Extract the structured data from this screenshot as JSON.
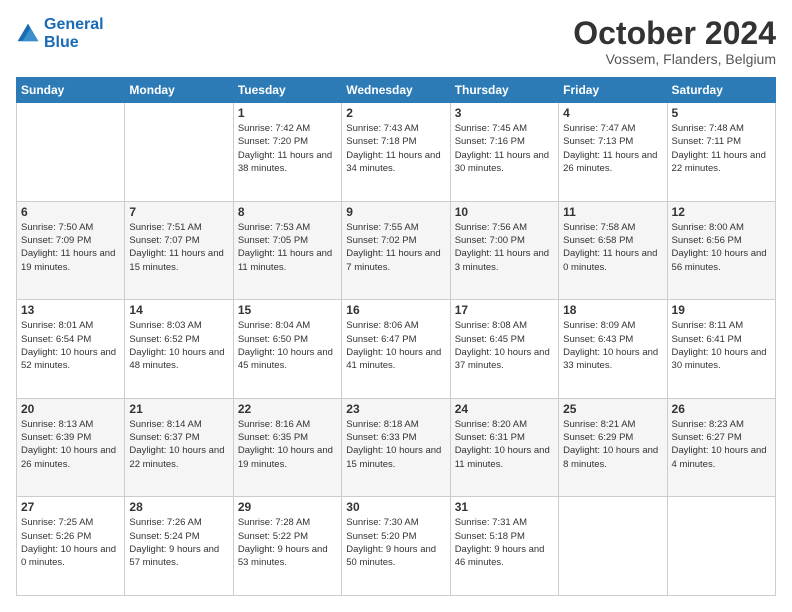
{
  "header": {
    "logo_line1": "General",
    "logo_line2": "Blue",
    "month": "October 2024",
    "location": "Vossem, Flanders, Belgium"
  },
  "weekdays": [
    "Sunday",
    "Monday",
    "Tuesday",
    "Wednesday",
    "Thursday",
    "Friday",
    "Saturday"
  ],
  "weeks": [
    [
      {
        "day": "",
        "info": ""
      },
      {
        "day": "",
        "info": ""
      },
      {
        "day": "1",
        "info": "Sunrise: 7:42 AM\nSunset: 7:20 PM\nDaylight: 11 hours and 38 minutes."
      },
      {
        "day": "2",
        "info": "Sunrise: 7:43 AM\nSunset: 7:18 PM\nDaylight: 11 hours and 34 minutes."
      },
      {
        "day": "3",
        "info": "Sunrise: 7:45 AM\nSunset: 7:16 PM\nDaylight: 11 hours and 30 minutes."
      },
      {
        "day": "4",
        "info": "Sunrise: 7:47 AM\nSunset: 7:13 PM\nDaylight: 11 hours and 26 minutes."
      },
      {
        "day": "5",
        "info": "Sunrise: 7:48 AM\nSunset: 7:11 PM\nDaylight: 11 hours and 22 minutes."
      }
    ],
    [
      {
        "day": "6",
        "info": "Sunrise: 7:50 AM\nSunset: 7:09 PM\nDaylight: 11 hours and 19 minutes."
      },
      {
        "day": "7",
        "info": "Sunrise: 7:51 AM\nSunset: 7:07 PM\nDaylight: 11 hours and 15 minutes."
      },
      {
        "day": "8",
        "info": "Sunrise: 7:53 AM\nSunset: 7:05 PM\nDaylight: 11 hours and 11 minutes."
      },
      {
        "day": "9",
        "info": "Sunrise: 7:55 AM\nSunset: 7:02 PM\nDaylight: 11 hours and 7 minutes."
      },
      {
        "day": "10",
        "info": "Sunrise: 7:56 AM\nSunset: 7:00 PM\nDaylight: 11 hours and 3 minutes."
      },
      {
        "day": "11",
        "info": "Sunrise: 7:58 AM\nSunset: 6:58 PM\nDaylight: 11 hours and 0 minutes."
      },
      {
        "day": "12",
        "info": "Sunrise: 8:00 AM\nSunset: 6:56 PM\nDaylight: 10 hours and 56 minutes."
      }
    ],
    [
      {
        "day": "13",
        "info": "Sunrise: 8:01 AM\nSunset: 6:54 PM\nDaylight: 10 hours and 52 minutes."
      },
      {
        "day": "14",
        "info": "Sunrise: 8:03 AM\nSunset: 6:52 PM\nDaylight: 10 hours and 48 minutes."
      },
      {
        "day": "15",
        "info": "Sunrise: 8:04 AM\nSunset: 6:50 PM\nDaylight: 10 hours and 45 minutes."
      },
      {
        "day": "16",
        "info": "Sunrise: 8:06 AM\nSunset: 6:47 PM\nDaylight: 10 hours and 41 minutes."
      },
      {
        "day": "17",
        "info": "Sunrise: 8:08 AM\nSunset: 6:45 PM\nDaylight: 10 hours and 37 minutes."
      },
      {
        "day": "18",
        "info": "Sunrise: 8:09 AM\nSunset: 6:43 PM\nDaylight: 10 hours and 33 minutes."
      },
      {
        "day": "19",
        "info": "Sunrise: 8:11 AM\nSunset: 6:41 PM\nDaylight: 10 hours and 30 minutes."
      }
    ],
    [
      {
        "day": "20",
        "info": "Sunrise: 8:13 AM\nSunset: 6:39 PM\nDaylight: 10 hours and 26 minutes."
      },
      {
        "day": "21",
        "info": "Sunrise: 8:14 AM\nSunset: 6:37 PM\nDaylight: 10 hours and 22 minutes."
      },
      {
        "day": "22",
        "info": "Sunrise: 8:16 AM\nSunset: 6:35 PM\nDaylight: 10 hours and 19 minutes."
      },
      {
        "day": "23",
        "info": "Sunrise: 8:18 AM\nSunset: 6:33 PM\nDaylight: 10 hours and 15 minutes."
      },
      {
        "day": "24",
        "info": "Sunrise: 8:20 AM\nSunset: 6:31 PM\nDaylight: 10 hours and 11 minutes."
      },
      {
        "day": "25",
        "info": "Sunrise: 8:21 AM\nSunset: 6:29 PM\nDaylight: 10 hours and 8 minutes."
      },
      {
        "day": "26",
        "info": "Sunrise: 8:23 AM\nSunset: 6:27 PM\nDaylight: 10 hours and 4 minutes."
      }
    ],
    [
      {
        "day": "27",
        "info": "Sunrise: 7:25 AM\nSunset: 5:26 PM\nDaylight: 10 hours and 0 minutes."
      },
      {
        "day": "28",
        "info": "Sunrise: 7:26 AM\nSunset: 5:24 PM\nDaylight: 9 hours and 57 minutes."
      },
      {
        "day": "29",
        "info": "Sunrise: 7:28 AM\nSunset: 5:22 PM\nDaylight: 9 hours and 53 minutes."
      },
      {
        "day": "30",
        "info": "Sunrise: 7:30 AM\nSunset: 5:20 PM\nDaylight: 9 hours and 50 minutes."
      },
      {
        "day": "31",
        "info": "Sunrise: 7:31 AM\nSunset: 5:18 PM\nDaylight: 9 hours and 46 minutes."
      },
      {
        "day": "",
        "info": ""
      },
      {
        "day": "",
        "info": ""
      }
    ]
  ]
}
